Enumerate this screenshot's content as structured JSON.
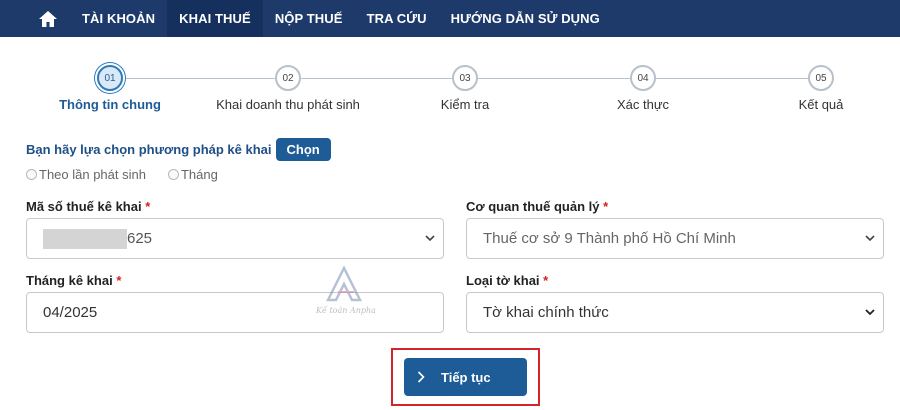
{
  "nav": {
    "items": [
      "TÀI KHOẢN",
      "KHAI THUẾ",
      "NỘP THUẾ",
      "TRA CỨU",
      "HƯỚNG DẪN SỬ DỤNG"
    ],
    "active_index": 1,
    "color": "#1d3a6b"
  },
  "stepper": {
    "steps": [
      {
        "num": "01",
        "label": "Thông tin chung"
      },
      {
        "num": "02",
        "label": "Khai doanh thu phát sinh"
      },
      {
        "num": "03",
        "label": "Kiểm tra"
      },
      {
        "num": "04",
        "label": "Xác thực"
      },
      {
        "num": "05",
        "label": "Kết quả"
      }
    ],
    "active_index": 0
  },
  "method": {
    "prompt": "Bạn hãy lựa chọn phương pháp kê khai",
    "button_label": "Chọn",
    "options": [
      "Theo lần phát sinh",
      "Tháng"
    ]
  },
  "form": {
    "tax_code": {
      "label": "Mã số thuế kê khai",
      "value_suffix": "625"
    },
    "tax_office": {
      "label": "Cơ quan thuế quản lý",
      "value": "Thuế cơ sở 9 Thành phố Hồ Chí Minh"
    },
    "period": {
      "label": "Tháng kê khai",
      "value": "04/2025"
    },
    "form_type": {
      "label": "Loại tờ khai",
      "value": "Tờ khai chính thức"
    },
    "required_mark": "*"
  },
  "actions": {
    "continue_label": "Tiếp tục",
    "highlight_color": "#d3242b"
  },
  "watermark": {
    "text": "Kế toán Anpha"
  }
}
